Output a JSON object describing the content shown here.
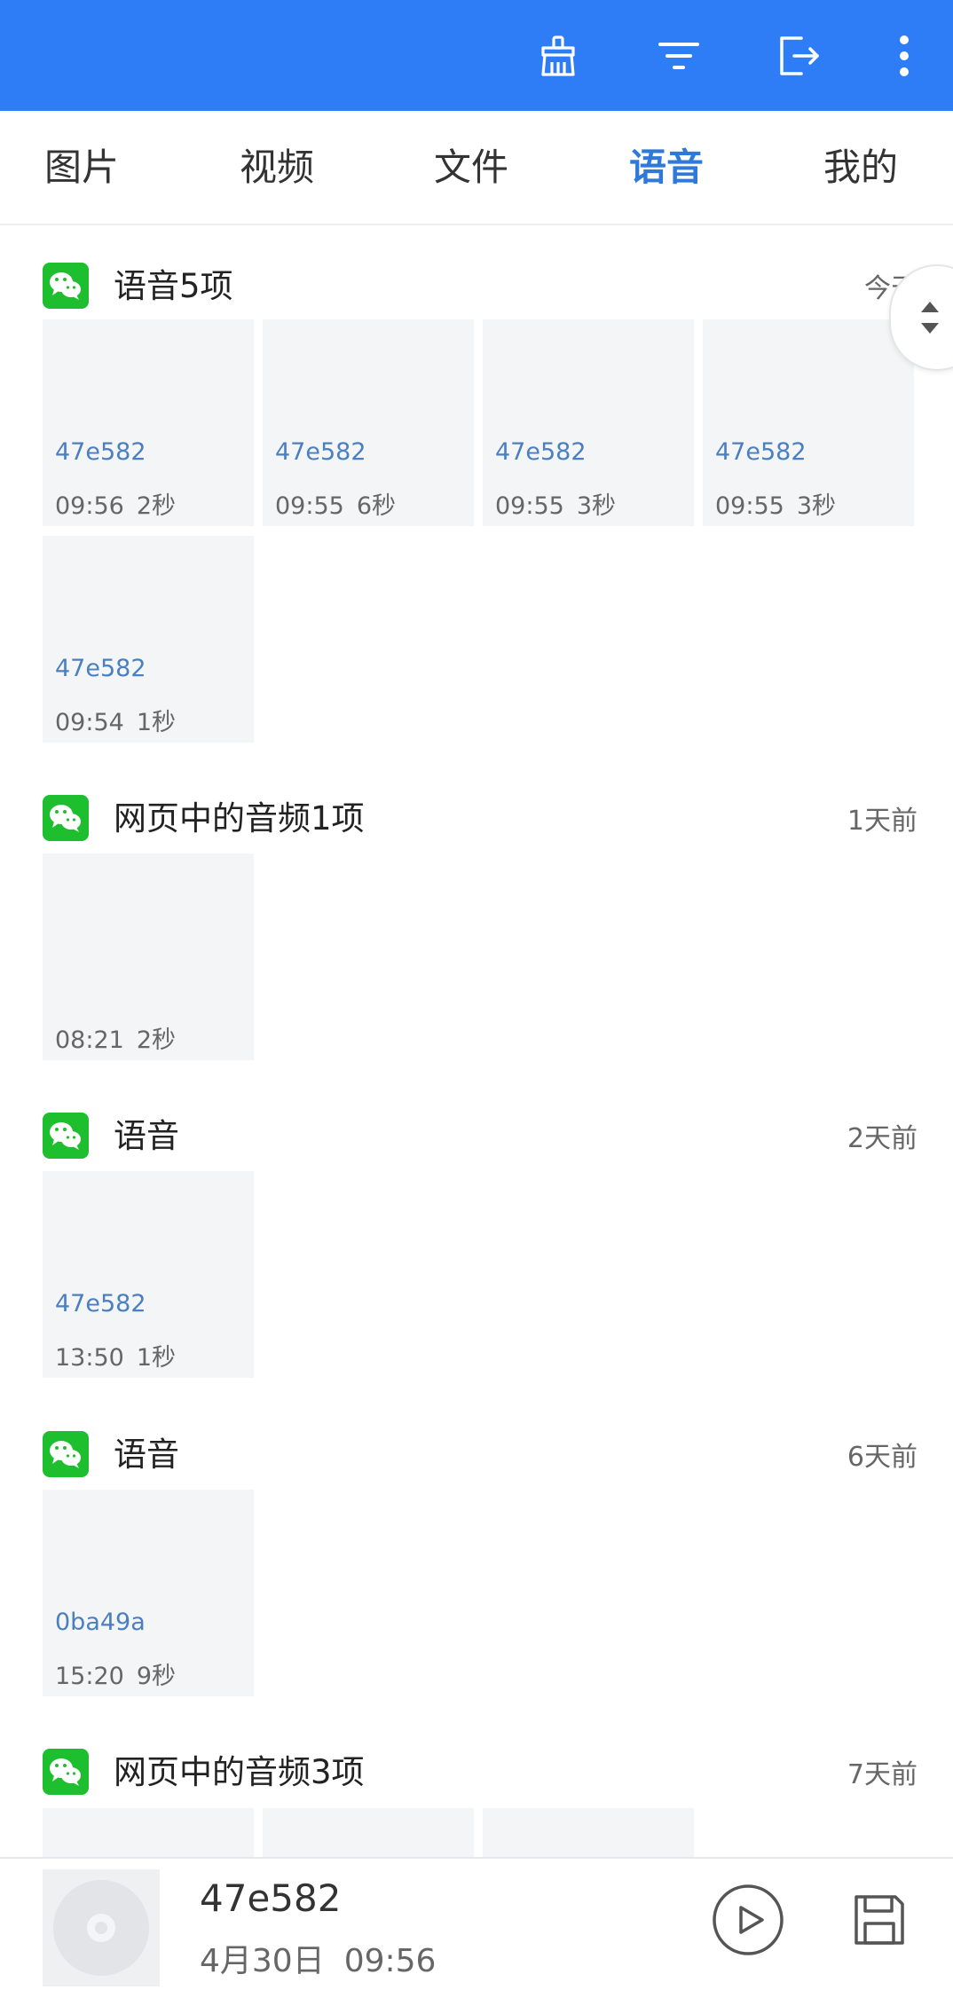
{
  "toolbar": {
    "icons": [
      "broom-icon",
      "filter-icon",
      "exit-icon",
      "more-vertical-icon"
    ],
    "background": "#2e7cf6"
  },
  "tabs": [
    {
      "label": "图片",
      "active": false
    },
    {
      "label": "视频",
      "active": false
    },
    {
      "label": "文件",
      "active": false
    },
    {
      "label": "语音",
      "active": true
    },
    {
      "label": "我的",
      "active": false
    }
  ],
  "accent_color": "#2f7ad8",
  "app_icon_color": "#1ebf2e",
  "sections": [
    {
      "title": "语音5项",
      "date": "今天",
      "items": [
        {
          "name": "47e582",
          "time": "09:56",
          "duration": "2秒"
        },
        {
          "name": "47e582",
          "time": "09:55",
          "duration": "6秒"
        },
        {
          "name": "47e582",
          "time": "09:55",
          "duration": "3秒"
        },
        {
          "name": "47e582",
          "time": "09:55",
          "duration": "3秒"
        },
        {
          "name": "47e582",
          "time": "09:54",
          "duration": "1秒"
        }
      ]
    },
    {
      "title": "网页中的音频1项",
      "date": "1天前",
      "items": [
        {
          "name": "",
          "time": "08:21",
          "duration": "2秒"
        }
      ]
    },
    {
      "title": "语音",
      "date": "2天前",
      "items": [
        {
          "name": "47e582",
          "time": "13:50",
          "duration": "1秒"
        }
      ]
    },
    {
      "title": "语音",
      "date": "6天前",
      "items": [
        {
          "name": "0ba49a",
          "time": "15:20",
          "duration": "9秒"
        }
      ]
    },
    {
      "title": "网页中的音频3项",
      "date": "7天前",
      "items": [
        {
          "name": "",
          "time": "",
          "duration": ""
        },
        {
          "name": "",
          "time": "",
          "duration": ""
        },
        {
          "name": "",
          "time": "",
          "duration": ""
        }
      ]
    }
  ],
  "player": {
    "title": "47e582",
    "date": "4月30日",
    "time": "09:56"
  }
}
